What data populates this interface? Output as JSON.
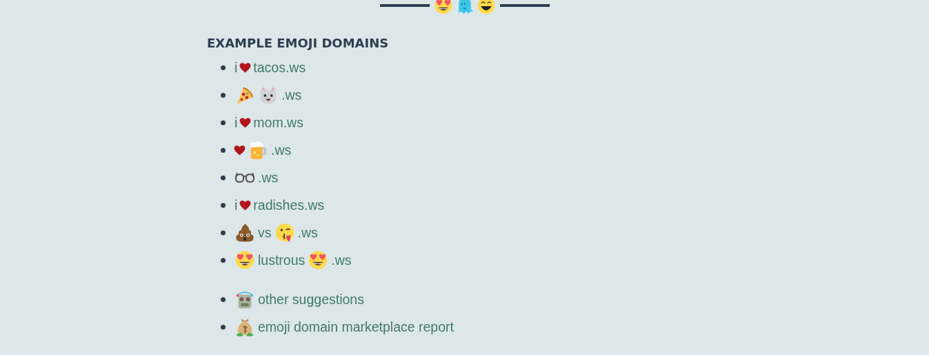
{
  "header": {
    "icons": [
      {
        "kind": "hearteyes"
      },
      {
        "kind": "ghost"
      },
      {
        "kind": "grin"
      }
    ]
  },
  "heading": "EXAMPLE EMOJI DOMAINS",
  "domains": [
    {
      "parts": [
        {
          "kind": "text",
          "text": "i"
        },
        {
          "kind": "heart"
        },
        {
          "kind": "text",
          "text": "tacos.ws"
        }
      ]
    },
    {
      "parts": [
        {
          "kind": "pizza"
        },
        {
          "kind": "cat"
        },
        {
          "kind": "text",
          "text": ".ws"
        }
      ]
    },
    {
      "parts": [
        {
          "kind": "text",
          "text": "i"
        },
        {
          "kind": "heart"
        },
        {
          "kind": "text",
          "text": "mom.ws"
        }
      ]
    },
    {
      "parts": [
        {
          "kind": "heart"
        },
        {
          "kind": "beer"
        },
        {
          "kind": "text",
          "text": ".ws"
        }
      ]
    },
    {
      "parts": [
        {
          "kind": "glasses"
        },
        {
          "kind": "text",
          "text": ".ws"
        }
      ]
    },
    {
      "parts": [
        {
          "kind": "text",
          "text": "i"
        },
        {
          "kind": "heart"
        },
        {
          "kind": "text",
          "text": "radishes.ws"
        }
      ]
    },
    {
      "parts": [
        {
          "kind": "poop"
        },
        {
          "kind": "text",
          "text": "vs"
        },
        {
          "kind": "kiss"
        },
        {
          "kind": "text",
          "text": ".ws"
        }
      ]
    },
    {
      "parts": [
        {
          "kind": "hearteyes"
        },
        {
          "kind": "text",
          "text": "lustrous"
        },
        {
          "kind": "hearteyes"
        },
        {
          "kind": "text",
          "text": ".ws"
        }
      ]
    }
  ],
  "links": [
    {
      "parts": [
        {
          "kind": "robot"
        },
        {
          "kind": "text",
          "text": "other suggestions"
        }
      ]
    },
    {
      "parts": [
        {
          "kind": "moneybag"
        },
        {
          "kind": "text",
          "text": "emoji domain marketplace report"
        }
      ]
    }
  ]
}
